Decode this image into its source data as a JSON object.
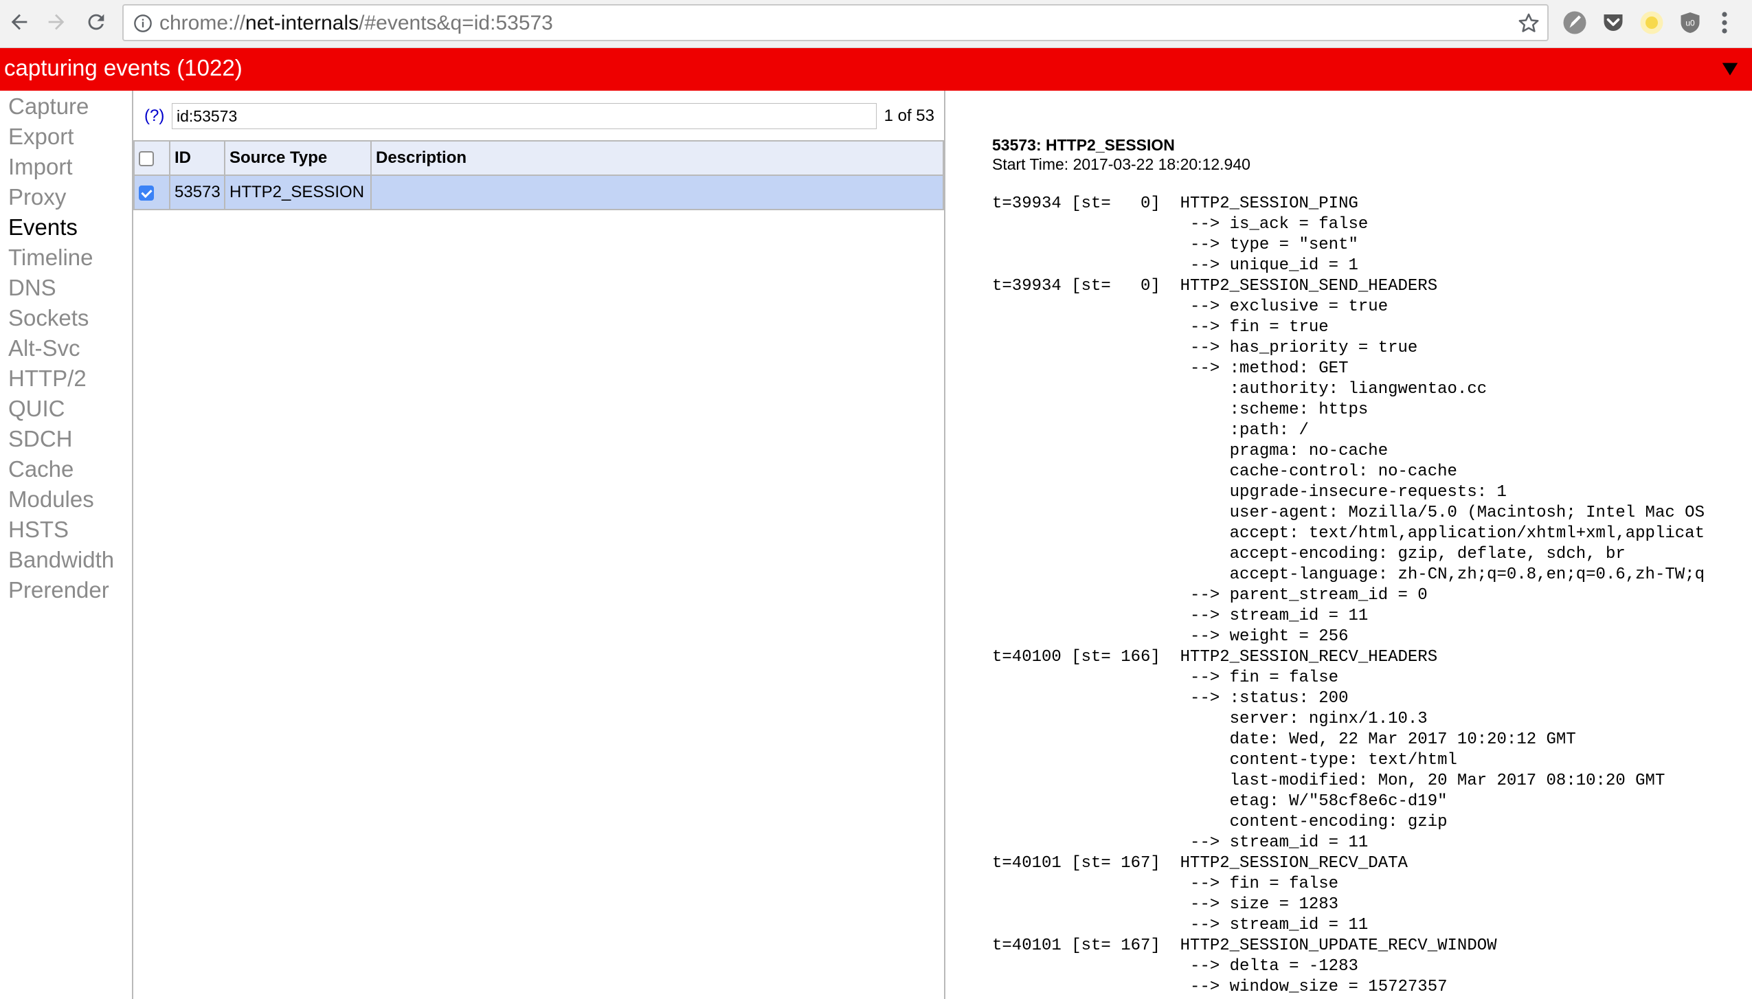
{
  "browser": {
    "url_prefix": "chrome://",
    "url_host": "net-internals",
    "url_path": "/#events&q=id:53573",
    "icons": [
      "back-arrow-icon",
      "forward-arrow-icon",
      "reload-icon",
      "info-icon",
      "star-icon",
      "extension-pen-icon",
      "pocket-icon",
      "extension-yellow-circle-icon",
      "ublock-icon",
      "menu-kebab-icon"
    ]
  },
  "status": {
    "text": "capturing events (1022)",
    "color": "#ee0000"
  },
  "nav": {
    "items": [
      "Capture",
      "Export",
      "Import",
      "Proxy",
      "Events",
      "Timeline",
      "DNS",
      "Sockets",
      "Alt-Svc",
      "HTTP/2",
      "QUIC",
      "SDCH",
      "Cache",
      "Modules",
      "HSTS",
      "Bandwidth",
      "Prerender"
    ],
    "active": "Events"
  },
  "events": {
    "help_label": "(?)",
    "filter_value": "id:53573",
    "count": "1 of 53",
    "columns": [
      "ID",
      "Source Type",
      "Description"
    ],
    "rows": [
      {
        "checked": true,
        "id": "53573",
        "source_type": "HTTP2_SESSION",
        "description": ""
      }
    ]
  },
  "details": {
    "title": "53573: HTTP2_SESSION",
    "start_time": "Start Time: 2017-03-22 18:20:12.940",
    "lines": [
      "t=39934 [st=   0]  HTTP2_SESSION_PING",
      "                    --> is_ack = false",
      "                    --> type = \"sent\"",
      "                    --> unique_id = 1",
      "t=39934 [st=   0]  HTTP2_SESSION_SEND_HEADERS",
      "                    --> exclusive = true",
      "                    --> fin = true",
      "                    --> has_priority = true",
      "                    --> :method: GET",
      "                        :authority: liangwentao.cc",
      "                        :scheme: https",
      "                        :path: /",
      "                        pragma: no-cache",
      "                        cache-control: no-cache",
      "                        upgrade-insecure-requests: 1",
      "                        user-agent: Mozilla/5.0 (Macintosh; Intel Mac OS",
      "                        accept: text/html,application/xhtml+xml,applicat",
      "                        accept-encoding: gzip, deflate, sdch, br",
      "                        accept-language: zh-CN,zh;q=0.8,en;q=0.6,zh-TW;q",
      "                    --> parent_stream_id = 0",
      "                    --> stream_id = 11",
      "                    --> weight = 256",
      "t=40100 [st= 166]  HTTP2_SESSION_RECV_HEADERS",
      "                    --> fin = false",
      "                    --> :status: 200",
      "                        server: nginx/1.10.3",
      "                        date: Wed, 22 Mar 2017 10:20:12 GMT",
      "                        content-type: text/html",
      "                        last-modified: Mon, 20 Mar 2017 08:10:20 GMT",
      "                        etag: W/\"58cf8e6c-d19\"",
      "                        content-encoding: gzip",
      "                    --> stream_id = 11",
      "t=40101 [st= 167]  HTTP2_SESSION_RECV_DATA",
      "                    --> fin = false",
      "                    --> size = 1283",
      "                    --> stream_id = 11",
      "t=40101 [st= 167]  HTTP2_SESSION_UPDATE_RECV_WINDOW",
      "                    --> delta = -1283",
      "                    --> window_size = 15727357"
    ]
  }
}
